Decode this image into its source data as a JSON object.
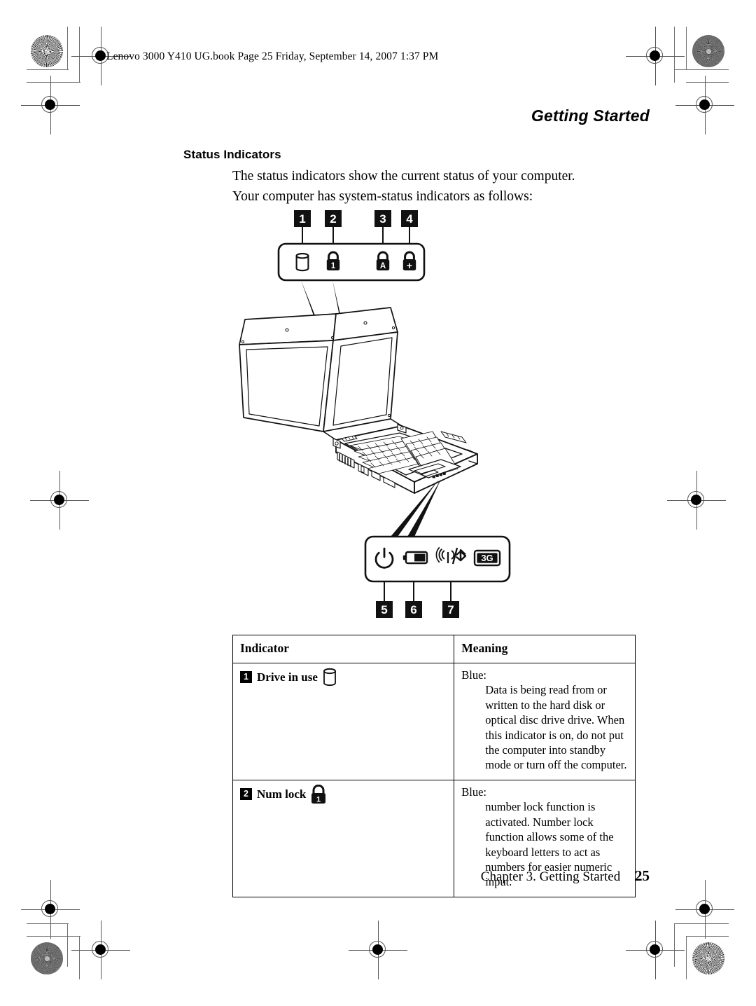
{
  "page": {
    "filename_header": "Lenovo 3000 Y410 UG.book  Page 25  Friday, September 14, 2007  1:37 PM",
    "running_head": "Getting Started",
    "section_heading": "Status Indicators",
    "intro_line_1": "The status indicators show the current status of your computer.",
    "intro_line_2": "Your computer has system-status indicators as follows:",
    "footer_text": "Chapter 3. Getting Started",
    "page_number": "25"
  },
  "figure": {
    "top_callouts": [
      {
        "number": "1",
        "icon": "drive-cylinder-icon",
        "glyph": ""
      },
      {
        "number": "2",
        "icon": "padlock-numlock-icon",
        "glyph": "1"
      },
      {
        "number": "3",
        "icon": "padlock-capslock-icon",
        "glyph": "A"
      },
      {
        "number": "4",
        "icon": "padlock-scrolllock-icon",
        "glyph": "+"
      }
    ],
    "bottom_callouts": [
      {
        "number": "5",
        "icon": "power-icon",
        "glyph": ""
      },
      {
        "number": "6",
        "icon": "battery-icon",
        "glyph": ""
      },
      {
        "number": "7",
        "icon": "wireless-bluetooth-icon",
        "glyph": ""
      }
    ],
    "bottom_extra_icon": {
      "icon": "three-g-icon",
      "glyph": "3G"
    },
    "illustration": "laptop-line-drawing"
  },
  "table": {
    "headers": {
      "indicator": "Indicator",
      "meaning": "Meaning"
    },
    "rows": [
      {
        "number": "1",
        "name": "Drive in use",
        "icon": "drive-cylinder-icon",
        "icon_glyph": "",
        "meaning_head": "Blue:",
        "meaning_body": "Data is being read from or written to the hard disk or optical disc drive drive. When this indicator is on, do not put the computer into standby mode or turn off the computer."
      },
      {
        "number": "2",
        "name": "Num lock",
        "icon": "padlock-numlock-icon",
        "icon_glyph": "1",
        "meaning_head": "Blue:",
        "meaning_body": "number lock function is activated. Number lock function allows some of the keyboard letters to act as numbers for easier numeric input."
      }
    ]
  },
  "colors": {
    "ink": "#000000",
    "paper": "#ffffff",
    "registration_gray": "#6f6f6f"
  }
}
